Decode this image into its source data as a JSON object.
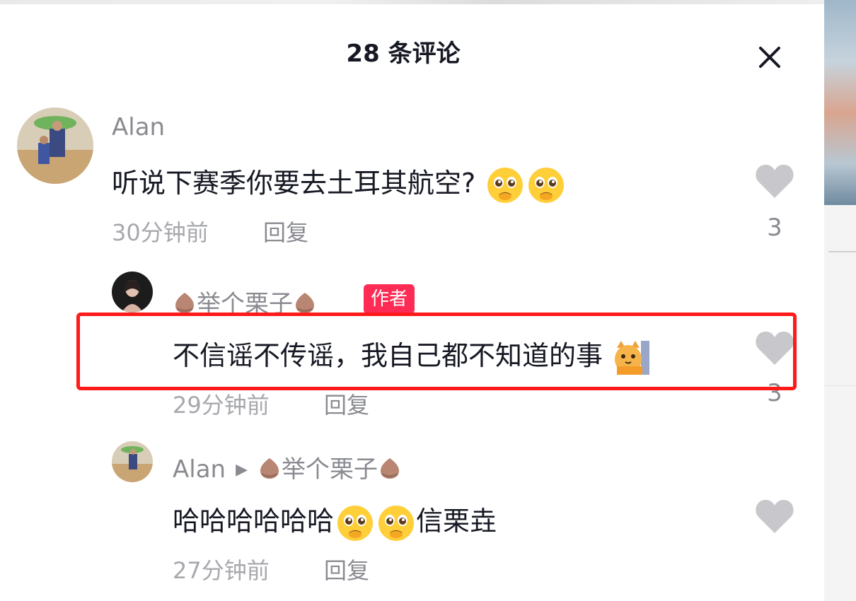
{
  "header": {
    "title": "28 条评论",
    "close_icon": "close-icon"
  },
  "comments": [
    {
      "user": "Alan",
      "text": "听说下赛季你要去土耳其航空?",
      "emojis": [
        "pleading-face-icon",
        "pleading-face-icon"
      ],
      "time": "30分钟前",
      "reply_label": "回复",
      "likes": "3"
    },
    {
      "user": "举个栗子",
      "badge": "作者",
      "text": "不信谣不传谣，我自己都不知道的事",
      "emoji": "hiding-cat-icon",
      "time": "29分钟前",
      "reply_label": "回复",
      "likes": "3"
    },
    {
      "user": "Alan",
      "reply_to": "举个栗子",
      "text_before": "哈哈哈哈哈哈",
      "text_after": "信栗垚",
      "emojis": [
        "pleading-face-icon",
        "pleading-face-icon"
      ],
      "time": "27分钟前",
      "reply_label": "回复"
    }
  ],
  "colors": {
    "highlight_border": "#ff1a1a",
    "author_badge": "#fe2c55",
    "muted_text": "#a7a8ad",
    "like_icon": "#c8c8cc"
  }
}
